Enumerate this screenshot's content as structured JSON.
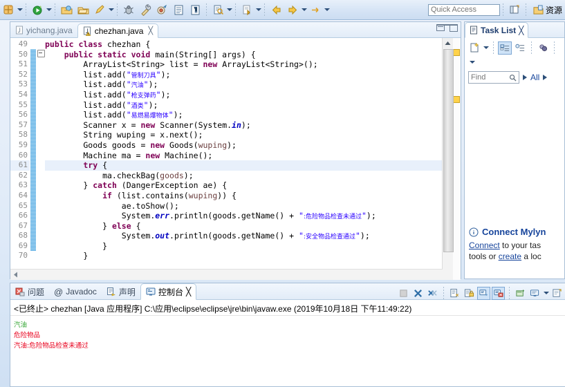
{
  "toolbar": {
    "icons": [
      {
        "name": "new-wizard-icon",
        "glyph": "new"
      },
      {
        "name": "debug-run-icon",
        "glyph": "run-green"
      },
      {
        "name": "debug-dropdown-arrow",
        "glyph": "arrow"
      },
      {
        "name": "open-type-icon",
        "glyph": "folder-open"
      },
      {
        "name": "open-resource-icon",
        "glyph": "folder"
      },
      {
        "name": "run-last-icon",
        "glyph": "run-yellow"
      },
      {
        "name": "run-dropdown-arrow",
        "glyph": "arrow"
      },
      {
        "name": "debug-icon",
        "glyph": "bug"
      },
      {
        "name": "external-tools-icon",
        "glyph": "wrench"
      },
      {
        "name": "coverage-icon",
        "glyph": "coverage"
      },
      {
        "name": "new-java-class-icon",
        "glyph": "class"
      },
      {
        "name": "new-package-icon",
        "glyph": "package"
      },
      {
        "name": "search-icon",
        "glyph": "search-doc"
      },
      {
        "name": "search-dropdown-arrow",
        "glyph": "arrow"
      },
      {
        "name": "next-annotation-icon",
        "glyph": "next-anno"
      },
      {
        "name": "next-dropdown-arrow",
        "glyph": "arrow"
      },
      {
        "name": "back-icon",
        "glyph": "back-yellow"
      },
      {
        "name": "forward-icon",
        "glyph": "forward-yellow"
      },
      {
        "name": "forward-dropdown-arrow",
        "glyph": "arrow"
      },
      {
        "name": "last-edit-icon",
        "glyph": "last-edit"
      },
      {
        "name": "last-edit-dropdown-arrow",
        "glyph": "arrow"
      }
    ],
    "quick_access_placeholder": "Quick Access",
    "open_perspective_icon": "open-perspective-icon",
    "perspective_label": "资源"
  },
  "editor": {
    "tabs": [
      {
        "label": "yichang.java",
        "active": false,
        "icon": "java-file-icon",
        "closable": false
      },
      {
        "label": "chezhan.java",
        "active": true,
        "icon": "java-file-warning-icon",
        "closable": true
      }
    ],
    "close_glyph": "╳",
    "minimize_title": "Minimize",
    "maximize_title": "Maximize",
    "first_line_number": 49,
    "highlighted_line": 61,
    "lines": [
      {
        "n": 49,
        "html": "<span class=\"kw\">public class</span> chezhan {"
      },
      {
        "n": 50,
        "html": "    <span class=\"kw\">public static void</span> main(String[] args) {",
        "fold": true
      },
      {
        "n": 51,
        "html": "        ArrayList&lt;String&gt; list = <span class=\"kw\">new</span> ArrayList&lt;String&gt;();"
      },
      {
        "n": 52,
        "html": "        list.add(<span class=\"str\">\"</span><span class=\"cn\">管制刀具</span><span class=\"str\">\"</span>);"
      },
      {
        "n": 53,
        "html": "        list.add(<span class=\"str\">\"</span><span class=\"cn\">汽油</span><span class=\"str\">\"</span>);"
      },
      {
        "n": 54,
        "html": "        list.add(<span class=\"str\">\"</span><span class=\"cn\">枪支弹药</span><span class=\"str\">\"</span>);"
      },
      {
        "n": 55,
        "html": "        list.add(<span class=\"str\">\"</span><span class=\"cn\">酒类</span><span class=\"str\">\"</span>);"
      },
      {
        "n": 56,
        "html": "        list.add(<span class=\"str\">\"</span><span class=\"cn\">易燃易爆物体</span><span class=\"str\">\"</span>);"
      },
      {
        "n": 57,
        "html": "        Scanner x = <span class=\"kw\">new</span> Scanner(System.<span class=\"fld\">in</span>);"
      },
      {
        "n": 58,
        "html": "        String wuping = x.next();"
      },
      {
        "n": 59,
        "html": "        Goods goods = <span class=\"kw\">new</span> Goods(<span class=\"loc\">wuping</span>);"
      },
      {
        "n": 60,
        "html": "        Machine ma = <span class=\"kw\">new</span> Machine();"
      },
      {
        "n": 61,
        "html": "        <span class=\"kw\">try</span> {"
      },
      {
        "n": 62,
        "html": "            ma.checkBag(<span class=\"loc\">goods</span>);"
      },
      {
        "n": 63,
        "html": "        } <span class=\"kw\">catch</span> (DangerException ae) {"
      },
      {
        "n": 64,
        "html": "            <span class=\"kw\">if</span> (list.contains(<span class=\"loc\">wuping</span>)) {"
      },
      {
        "n": 65,
        "html": "                ae.toShow();"
      },
      {
        "n": 66,
        "html": "                System.<span class=\"fld\">err</span>.println(goods.getName() + <span class=\"str\">\"</span><span class=\"cn\">:危险物品检查未通过</span><span class=\"str\">\"</span>);"
      },
      {
        "n": 67,
        "html": "            } <span class=\"kw\">else</span> {"
      },
      {
        "n": 68,
        "html": "                System.<span class=\"fld\">out</span>.println(goods.getName() + <span class=\"str\">\"</span><span class=\"cn\">:安全物品检查通过</span><span class=\"str\">\"</span>);"
      },
      {
        "n": 69,
        "html": "            }"
      },
      {
        "n": 70,
        "html": "        }"
      }
    ]
  },
  "task_list": {
    "tab_label": "Task List",
    "tab_icon": "task-list-icon",
    "close_glyph": "╳",
    "toolbar": [
      {
        "name": "new-task-icon",
        "glyph": "new-task"
      },
      {
        "name": "new-task-dropdown-arrow",
        "glyph": "arrow"
      },
      {
        "name": "categorized-presentation-icon",
        "glyph": "tree",
        "active": true
      },
      {
        "name": "scheduled-presentation-icon",
        "glyph": "tree2",
        "active": false
      },
      {
        "name": "focus-on-workweek-icon",
        "glyph": "people",
        "active": false
      },
      {
        "name": "view-menu-icon",
        "glyph": "arrow-down"
      }
    ],
    "find_placeholder": "Find",
    "find_icon": "search-icon",
    "filter_prev_icon": "play-right-icon",
    "filter_label": "All",
    "filter_next_icon": "play-right-icon",
    "mylyn": {
      "info_icon": "info-icon",
      "title": "Connect Mylyn",
      "line1_link": "Connect",
      "line1_rest": " to your tas",
      "line2_pre": "tools or ",
      "line2_link": "create",
      "line2_rest": " a loc"
    }
  },
  "console": {
    "tabs": [
      {
        "label": "问题",
        "icon": "problems-icon",
        "active": false
      },
      {
        "label": "Javadoc",
        "icon": "javadoc-icon",
        "active": false
      },
      {
        "label": "声明",
        "icon": "declaration-icon",
        "active": false
      },
      {
        "label": "控制台",
        "icon": "console-icon",
        "active": true
      }
    ],
    "close_glyph": "╳",
    "tools": [
      {
        "name": "terminate-icon",
        "glyph": "terminate",
        "enabled": false,
        "active": false
      },
      {
        "name": "remove-launch-icon",
        "glyph": "x-blue",
        "enabled": true,
        "active": false
      },
      {
        "name": "remove-all-terminated-icon",
        "glyph": "xx-blue",
        "enabled": true,
        "active": false
      },
      {
        "name": "clear-console-icon",
        "glyph": "clear",
        "enabled": true,
        "active": false
      },
      {
        "name": "scroll-lock-icon",
        "glyph": "lock",
        "enabled": true,
        "active": false
      },
      {
        "name": "show-console-on-output-icon",
        "glyph": "show-out",
        "enabled": true,
        "active": true
      },
      {
        "name": "show-console-on-error-icon",
        "glyph": "show-err",
        "enabled": true,
        "active": true
      },
      {
        "name": "pin-console-icon",
        "glyph": "pin",
        "enabled": true,
        "active": false
      },
      {
        "name": "display-selected-console-icon",
        "glyph": "display",
        "enabled": true,
        "active": false
      },
      {
        "name": "display-console-dropdown-arrow",
        "glyph": "arrow",
        "enabled": true,
        "active": false
      },
      {
        "name": "open-console-icon",
        "glyph": "open-console",
        "enabled": true,
        "active": false
      }
    ],
    "header": "<已终止> chezhan [Java 应用程序] C:\\应用\\eclipse\\eclipse\\jre\\bin\\javaw.exe (2019年10月18日 下午11:49:22)",
    "output": [
      {
        "text": "汽油",
        "color": "#3aa83a",
        "kind": "input"
      },
      {
        "text": "危险物品",
        "color": "#e8001c",
        "kind": "error"
      },
      {
        "text": "汽油:危险物品检查未通过",
        "color": "#e8001c",
        "kind": "error"
      }
    ]
  },
  "colors": {
    "accent": "#16449b",
    "error": "#e8001c",
    "input": "#3aa83a",
    "keyword": "#7f0055",
    "string": "#2a00ff",
    "field": "#0000c0",
    "chrome": "#cbdcf1"
  }
}
